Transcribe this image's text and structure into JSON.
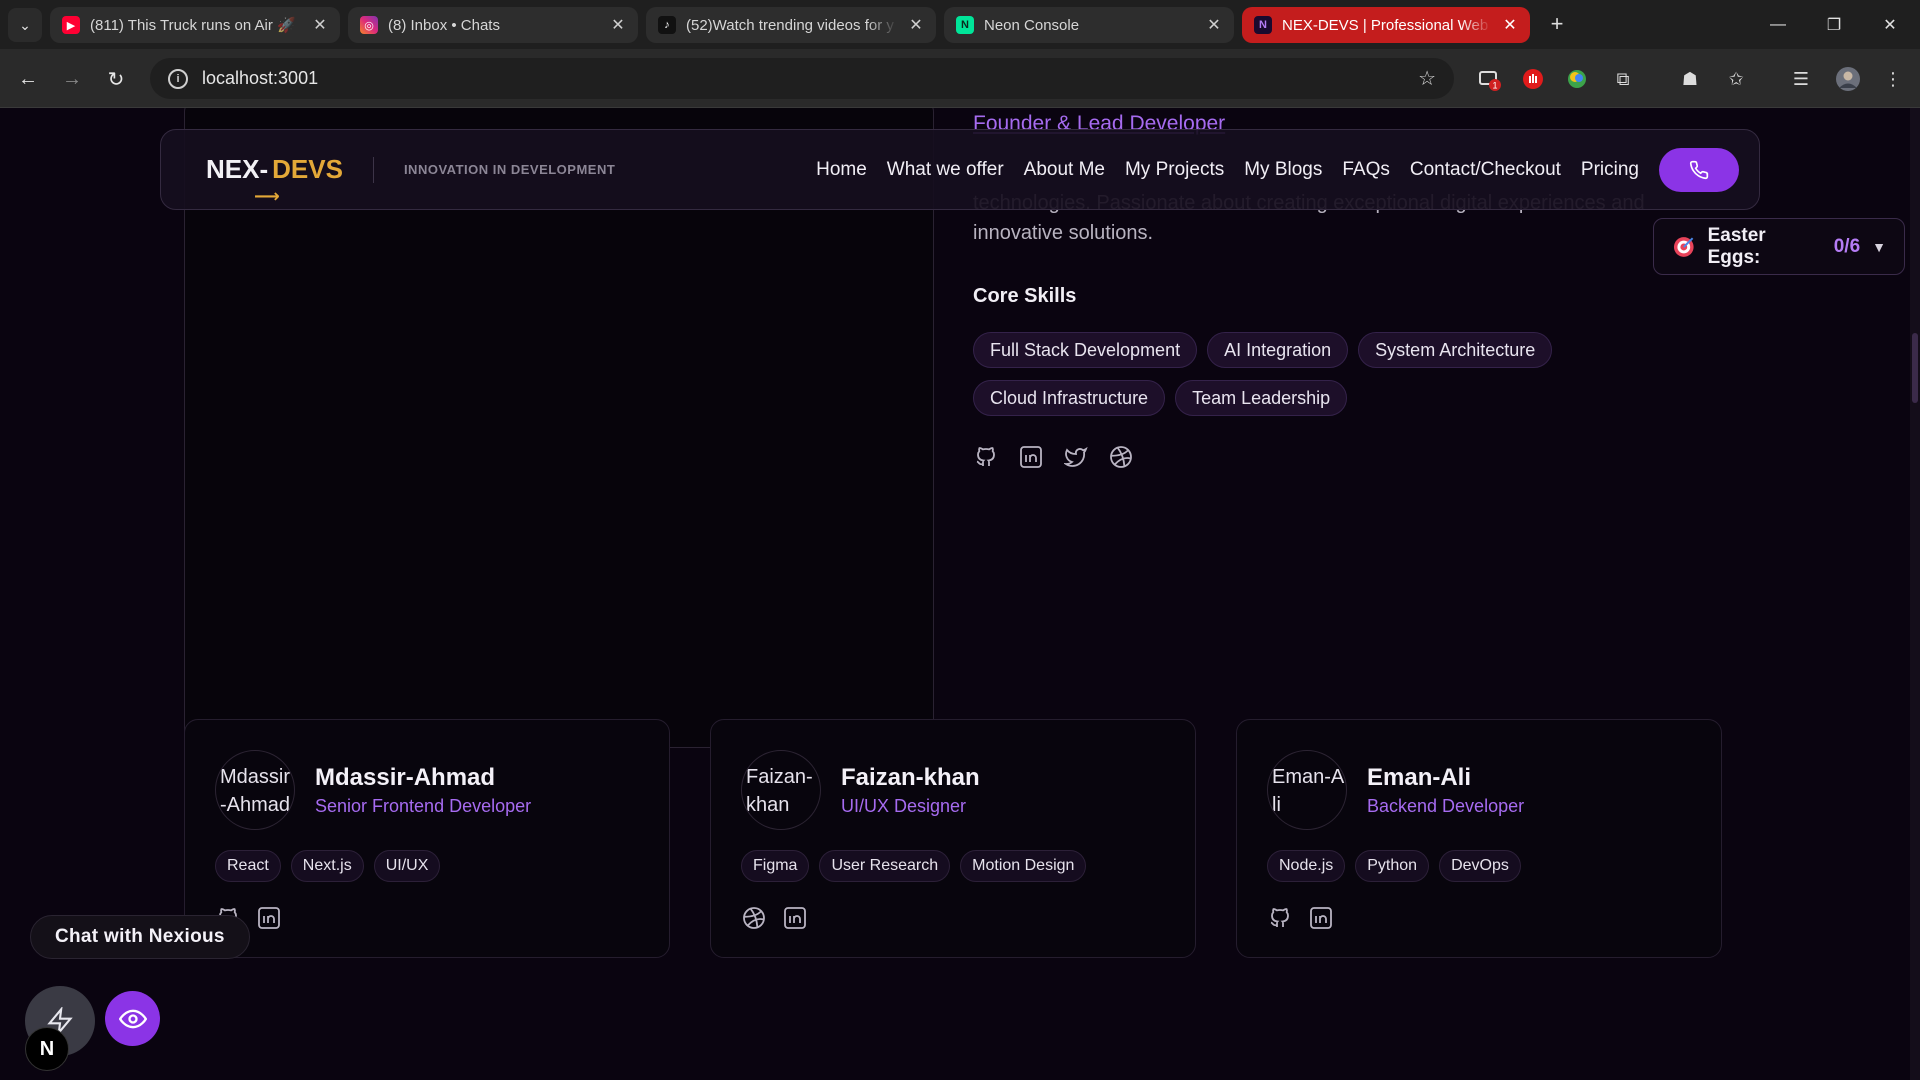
{
  "browser": {
    "tabs": [
      {
        "title": "(811) This Truck runs on Air 🚀",
        "favicon": "youtube-icon",
        "color": "#ff0033"
      },
      {
        "title": "(8) Inbox • Chats",
        "favicon": "instagram-icon",
        "color": "#d62976"
      },
      {
        "title": "(52)Watch trending videos for y",
        "favicon": "tiktok-icon",
        "color": "#000000"
      },
      {
        "title": "Neon Console",
        "favicon": "neon-icon",
        "color": "#00e599"
      },
      {
        "title": "NEX-DEVS | Professional Web D",
        "favicon": "nexdevs-icon",
        "color": "#1a0a2e"
      }
    ],
    "url": "localhost:3001",
    "extension_badge": "1"
  },
  "nav": {
    "logo_part1": "NEX-",
    "logo_part2": "DEVS",
    "tagline": "INNOVATION IN DEVELOPMENT",
    "items": [
      "Home",
      "What we offer",
      "About Me",
      "My Projects",
      "My Blogs",
      "FAQs",
      "Contact/Checkout",
      "Pricing"
    ]
  },
  "founder": {
    "role": "Founder & Lead Developer",
    "bio_partial": "technologies. Passionate about creating exceptional digital experiences and innovative solutions.",
    "skills_title": "Core Skills",
    "skills": [
      "Full Stack Development",
      "AI Integration",
      "System Architecture",
      "Cloud Infrastructure",
      "Team Leadership"
    ],
    "socials": [
      "github-icon",
      "linkedin-icon",
      "twitter-icon",
      "dribbble-icon"
    ]
  },
  "easter_eggs": {
    "label": "Easter Eggs:",
    "count": "0/6"
  },
  "team": [
    {
      "avatar_alt": "Mdassir-Ahmad",
      "name": "Mdassir-Ahmad",
      "role": "Senior Frontend Developer",
      "tags": [
        "React",
        "Next.js",
        "UI/UX"
      ],
      "socials": [
        "github-icon",
        "linkedin-icon"
      ]
    },
    {
      "avatar_alt": "Faizan-khan",
      "name": "Faizan-khan",
      "role": "UI/UX Designer",
      "tags": [
        "Figma",
        "User Research",
        "Motion Design"
      ],
      "socials": [
        "dribbble-icon",
        "linkedin-icon"
      ]
    },
    {
      "avatar_alt": "Eman-Ali",
      "name": "Eman-Ali",
      "role": "Backend Developer",
      "tags": [
        "Node.js",
        "Python",
        "DevOps"
      ],
      "socials": [
        "github-icon",
        "linkedin-icon"
      ]
    }
  ],
  "chat": {
    "label": "Chat with Nexious"
  },
  "fab": {
    "n_label": "N"
  },
  "colors": {
    "accent": "#8b34e6",
    "accent_text": "#a66bf0",
    "logo_gold": "#e3a838",
    "active_tab": "#c41d1d"
  }
}
